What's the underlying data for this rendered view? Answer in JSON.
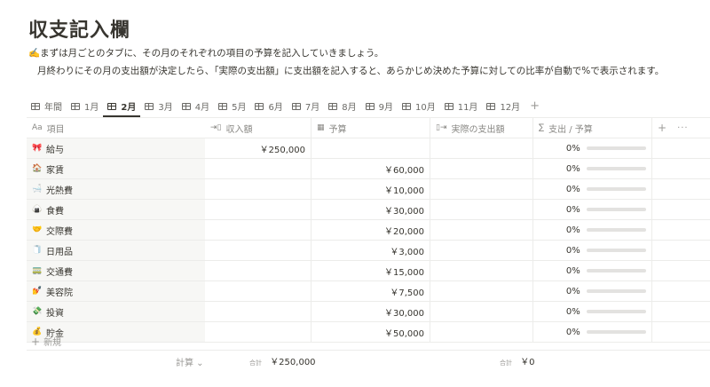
{
  "page": {
    "title": "収支記入欄",
    "desc_line1": "✍️まずは月ごとのタブに、その月のそれぞれの項目の予算を記入していきましょう。",
    "desc_line2": "月終わりにその月の支出額が決定したら、「実際の支出額」に支出額を記入すると、あらかじめ決めた予算に対しての比率が自動で%で表示されます。"
  },
  "tabs": [
    {
      "label": "年間"
    },
    {
      "label": "1月"
    },
    {
      "label": "2月",
      "active": true
    },
    {
      "label": "3月"
    },
    {
      "label": "4月"
    },
    {
      "label": "5月"
    },
    {
      "label": "6月"
    },
    {
      "label": "7月"
    },
    {
      "label": "8月"
    },
    {
      "label": "9月"
    },
    {
      "label": "10月"
    },
    {
      "label": "11月"
    },
    {
      "label": "12月"
    }
  ],
  "tab_add": "+",
  "columns": {
    "item": {
      "icon": "Aa",
      "label": "項目"
    },
    "income": {
      "icon": "⇥▯",
      "label": "収入額"
    },
    "budget": {
      "icon": "▦",
      "label": "予算"
    },
    "actual": {
      "icon": "▯⇥",
      "label": "実際の支出額"
    },
    "ratio": {
      "icon": "∑",
      "label": "支出 / 予算"
    },
    "add": "+",
    "more": "···"
  },
  "rows": [
    {
      "emoji": "🎀",
      "name": "給与",
      "income": "￥250,000",
      "budget": "",
      "actual": "",
      "ratio": "0%"
    },
    {
      "emoji": "🏠",
      "name": "家賃",
      "income": "",
      "budget": "￥60,000",
      "actual": "",
      "ratio": "0%"
    },
    {
      "emoji": "🛁",
      "name": "光熱費",
      "income": "",
      "budget": "￥10,000",
      "actual": "",
      "ratio": "0%"
    },
    {
      "emoji": "🍙",
      "name": "食費",
      "income": "",
      "budget": "￥30,000",
      "actual": "",
      "ratio": "0%"
    },
    {
      "emoji": "🤝",
      "name": "交際費",
      "income": "",
      "budget": "￥20,000",
      "actual": "",
      "ratio": "0%"
    },
    {
      "emoji": "🧻",
      "name": "日用品",
      "income": "",
      "budget": "￥3,000",
      "actual": "",
      "ratio": "0%"
    },
    {
      "emoji": "🚃",
      "name": "交通費",
      "income": "",
      "budget": "￥15,000",
      "actual": "",
      "ratio": "0%"
    },
    {
      "emoji": "💅",
      "name": "美容院",
      "income": "",
      "budget": "￥7,500",
      "actual": "",
      "ratio": "0%"
    },
    {
      "emoji": "💸",
      "name": "投資",
      "income": "",
      "budget": "￥30,000",
      "actual": "",
      "ratio": "0%"
    },
    {
      "emoji": "💰",
      "name": "貯金",
      "income": "",
      "budget": "￥50,000",
      "actual": "",
      "ratio": "0%"
    }
  ],
  "new_row": {
    "plus": "+",
    "label": "新規"
  },
  "footer": {
    "calc_label": "計算 ⌄",
    "sum_label": "合計",
    "income_total": "￥250,000",
    "actual_total": "￥0"
  },
  "colors": {
    "text": "#37352f",
    "muted": "#9b9a97",
    "border": "#ececea",
    "bar": "#e3e2e0"
  }
}
